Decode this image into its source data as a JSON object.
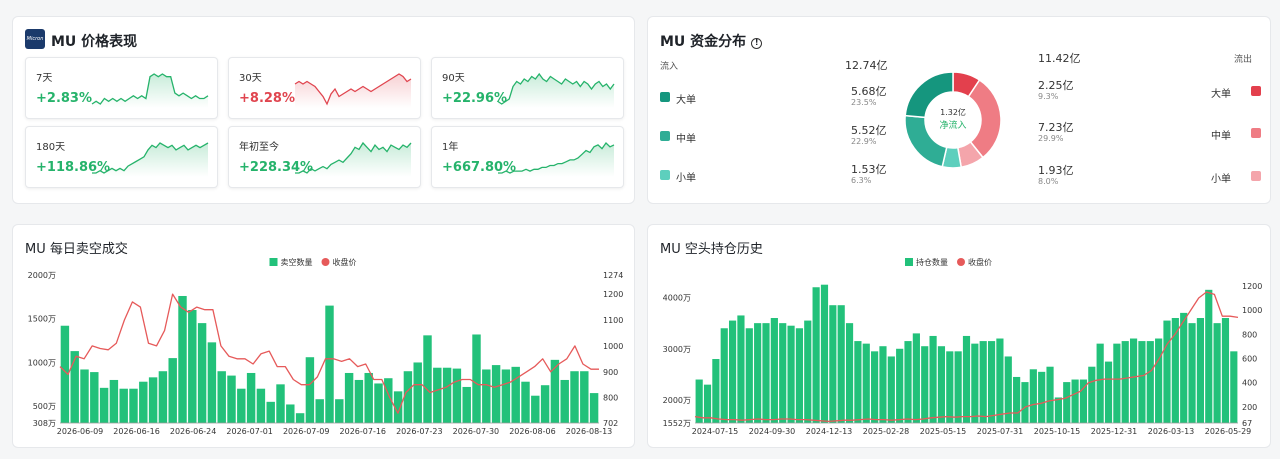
{
  "colors": {
    "up": "#26b36b",
    "down": "#e0454f",
    "bar": "#22c17a",
    "price": "#e65a5a",
    "in_large": "#15967e",
    "in_mid": "#2fad95",
    "in_small": "#5dcfbd",
    "out_large": "#e3404d",
    "out_mid": "#ef7c84",
    "out_small": "#f4a5ab"
  },
  "performance": {
    "title": "MU 价格表现",
    "logo_text": "Micron",
    "tiles": [
      {
        "label": "7天",
        "value": "+2.83%",
        "trend": "up",
        "spark": [
          10,
          11,
          10,
          12,
          11,
          12,
          11,
          12,
          11,
          12,
          13,
          12,
          13,
          12,
          20,
          21,
          20,
          21,
          20,
          20,
          14,
          13,
          14,
          13,
          12,
          13,
          12,
          12,
          13
        ]
      },
      {
        "label": "30天",
        "value": "+8.28%",
        "trend": "down",
        "spark": [
          15,
          16,
          15,
          16,
          15,
          14,
          12,
          10,
          7,
          11,
          13,
          10,
          11,
          12,
          13,
          12,
          13,
          14,
          13,
          12,
          13,
          14,
          15,
          16,
          17,
          18,
          19,
          18,
          16,
          17
        ]
      },
      {
        "label": "90天",
        "value": "+22.96%",
        "trend": "up",
        "spark": [
          8,
          7,
          8,
          9,
          14,
          16,
          15,
          17,
          16,
          18,
          17,
          19,
          17,
          16,
          18,
          17,
          16,
          15,
          17,
          16,
          15,
          16,
          14,
          16,
          15,
          13,
          15,
          16,
          14,
          15,
          13,
          15
        ]
      },
      {
        "label": "180天",
        "value": "+118.86%",
        "trend": "up",
        "spark": [
          5,
          5,
          6,
          5,
          6,
          7,
          6,
          7,
          6,
          8,
          9,
          10,
          11,
          12,
          15,
          17,
          16,
          18,
          17,
          16,
          17,
          15,
          16,
          17,
          15,
          16,
          17,
          16,
          17,
          18
        ]
      },
      {
        "label": "年初至今",
        "value": "+228.34%",
        "trend": "up",
        "spark": [
          3,
          3,
          4,
          3,
          5,
          4,
          5,
          6,
          5,
          7,
          8,
          9,
          8,
          10,
          12,
          15,
          14,
          17,
          15,
          13,
          16,
          14,
          15,
          13,
          16,
          15,
          14,
          16,
          15,
          17
        ]
      },
      {
        "label": "1年",
        "value": "+667.80%",
        "trend": "up",
        "spark": [
          2,
          2,
          3,
          2,
          3,
          3,
          3,
          4,
          3,
          4,
          4,
          5,
          5,
          6,
          6,
          7,
          7,
          8,
          9,
          9,
          10,
          12,
          14,
          13,
          16,
          17,
          15,
          18,
          16,
          17
        ]
      }
    ]
  },
  "flow": {
    "title": "MU 资金分布",
    "inflow_label": "流入",
    "inflow_total": "12.74亿",
    "outflow_label": "流出",
    "outflow_total": "11.42亿",
    "center_value": "1.32亿",
    "center_label": "净流入",
    "inflows": [
      {
        "label": "大单",
        "amount": "5.68亿",
        "pct": "23.5%",
        "value": 5.68
      },
      {
        "label": "中单",
        "amount": "5.52亿",
        "pct": "22.9%",
        "value": 5.52
      },
      {
        "label": "小单",
        "amount": "1.53亿",
        "pct": "6.3%",
        "value": 1.53
      }
    ],
    "outflows": [
      {
        "label": "大单",
        "amount": "2.25亿",
        "pct": "9.3%",
        "value": 2.25
      },
      {
        "label": "中单",
        "amount": "7.23亿",
        "pct": "29.9%",
        "value": 7.23
      },
      {
        "label": "小单",
        "amount": "1.93亿",
        "pct": "8.0%",
        "value": 1.93
      }
    ]
  },
  "chart_data": [
    {
      "type": "bar",
      "title": "MU 每日卖空成交",
      "legend": [
        "卖空数量",
        "收盘价"
      ],
      "legend_position": "top-center",
      "x_ticks": [
        "2026-06-09",
        "2026-06-16",
        "2026-06-24",
        "2026-07-01",
        "2026-07-09",
        "2026-07-16",
        "2026-07-23",
        "2026-07-30",
        "2026-08-06",
        "2026-08-13"
      ],
      "y_left_ticks": [
        "308万",
        "500万",
        "1000万",
        "1500万",
        "2000万"
      ],
      "y_left_range": [
        308,
        2000
      ],
      "y_right_ticks": [
        "702",
        "800",
        "900",
        "1000",
        "1100",
        "1200",
        "1274"
      ],
      "y_right_range": [
        702,
        1274
      ],
      "series": [
        {
          "name": "卖空数量",
          "unit": "万",
          "values": [
            1420,
            1130,
            920,
            890,
            710,
            800,
            700,
            700,
            780,
            830,
            900,
            1050,
            1760,
            1600,
            1450,
            1230,
            900,
            850,
            700,
            880,
            700,
            550,
            750,
            520,
            420,
            1060,
            580,
            1650,
            580,
            880,
            800,
            880,
            760,
            820,
            670,
            900,
            1000,
            1310,
            940,
            940,
            930,
            720,
            1320,
            920,
            970,
            920,
            950,
            780,
            620,
            740,
            1030,
            800,
            900,
            900,
            650
          ]
        },
        {
          "name": "收盘价",
          "values": [
            920,
            890,
            960,
            950,
            1000,
            990,
            985,
            1010,
            1100,
            1170,
            1150,
            1010,
            1000,
            1060,
            1200,
            1150,
            1130,
            1150,
            1140,
            1140,
            1000,
            960,
            950,
            950,
            930,
            970,
            980,
            920,
            920,
            870,
            850,
            850,
            880,
            950,
            950,
            940,
            950,
            920,
            930,
            870,
            870,
            800,
            740,
            820,
            850,
            850,
            820,
            830,
            840,
            860,
            870,
            870,
            850,
            850,
            840,
            850,
            860,
            880,
            900,
            920,
            950,
            900,
            930,
            950,
            1000,
            930,
            910,
            910
          ]
        }
      ]
    },
    {
      "type": "bar",
      "title": "MU 空头持仓历史",
      "legend": [
        "持仓数量",
        "收盘价"
      ],
      "legend_position": "top-center",
      "x_ticks": [
        "2024-07-15",
        "2024-09-30",
        "2024-12-13",
        "2025-02-28",
        "2025-05-15",
        "2025-07-31",
        "2025-10-15",
        "2025-12-31",
        "2026-03-13",
        "2026-05-29"
      ],
      "y_left_ticks": [
        "1552万",
        "2000万",
        "3000万",
        "4000万"
      ],
      "y_left_range": [
        1552,
        4400
      ],
      "y_right_ticks": [
        "67",
        "200",
        "400",
        "600",
        "800",
        "1000",
        "1200"
      ],
      "y_right_range": [
        67,
        1274
      ],
      "series": [
        {
          "name": "持仓数量",
          "unit": "万",
          "values": [
            2400,
            2300,
            2800,
            3400,
            3550,
            3650,
            3400,
            3500,
            3500,
            3600,
            3500,
            3450,
            3400,
            3550,
            4200,
            4250,
            3850,
            3850,
            3500,
            3150,
            3100,
            2950,
            3050,
            2850,
            3000,
            3150,
            3300,
            3050,
            3250,
            3050,
            2950,
            2950,
            3250,
            3100,
            3150,
            3150,
            3200,
            2850,
            2450,
            2350,
            2600,
            2550,
            2650,
            2050,
            2350,
            2400,
            2400,
            2650,
            3100,
            2750,
            3100,
            3150,
            3200,
            3150,
            3150,
            3200,
            3550,
            3600,
            3700,
            3500,
            3600,
            4150,
            3500,
            3600,
            2950
          ]
        },
        {
          "name": "收盘价",
          "values": [
            120,
            110,
            110,
            100,
            95,
            95,
            90,
            95,
            100,
            95,
            95,
            100,
            100,
            95,
            95,
            90,
            85,
            80,
            85,
            90,
            90,
            95,
            100,
            95,
            95,
            90,
            95,
            100,
            95,
            100,
            110,
            115,
            120,
            115,
            120,
            120,
            125,
            120,
            130,
            140,
            150,
            150,
            200,
            220,
            230,
            250,
            260,
            270,
            300,
            330,
            400,
            420,
            430,
            430,
            430,
            440,
            450,
            460,
            500,
            600,
            720,
            800,
            900,
            1000,
            1100,
            1150,
            1130,
            950,
            950,
            940
          ]
        }
      ]
    }
  ]
}
